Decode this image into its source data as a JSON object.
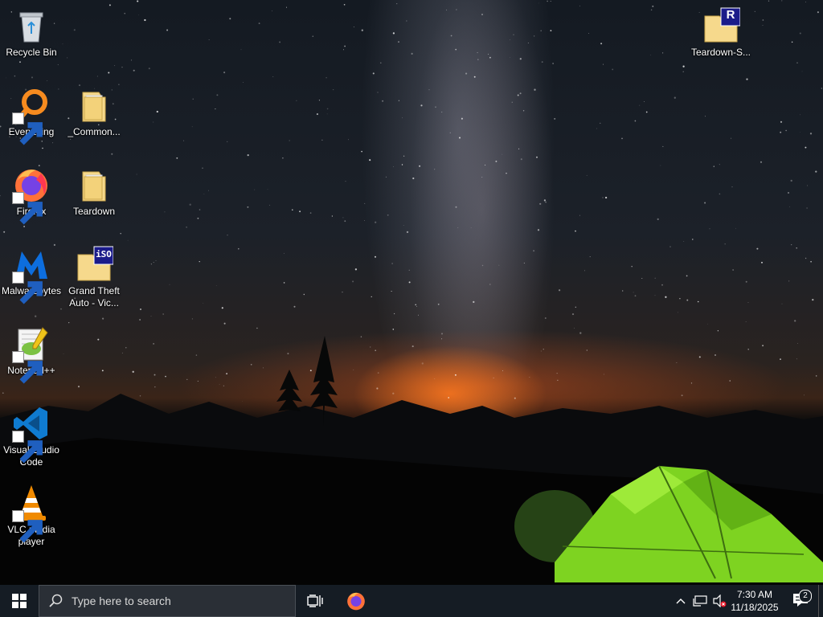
{
  "desktop_icons": [
    {
      "label": "Recycle Bin",
      "icon": "recycle-bin-icon"
    },
    {
      "label": "Everything",
      "icon": "everything-search-icon"
    },
    {
      "label": "_Common...",
      "icon": "folder-icon"
    },
    {
      "label": "Firefox",
      "icon": "firefox-icon"
    },
    {
      "label": "Teardown",
      "icon": "folder-icon"
    },
    {
      "label": "Malwarebytes",
      "icon": "malwarebytes-icon"
    },
    {
      "label": "Grand Theft Auto - Vic...",
      "icon": "iso-folder-icon",
      "badge": "iSO"
    },
    {
      "label": "Notepad++",
      "icon": "notepad-plus-plus-icon"
    },
    {
      "label": "Visual Studio Code",
      "icon": "vscode-icon"
    },
    {
      "label": "VLC media player",
      "icon": "vlc-icon"
    },
    {
      "label": "Teardown-S...",
      "icon": "rar-folder-icon",
      "badge": "R"
    }
  ],
  "taskbar": {
    "search_placeholder": "Type here to search",
    "pinned": [
      "firefox-icon"
    ],
    "tray": {
      "time": "7:30 AM",
      "date": "11/18/2025",
      "notification_count": "2",
      "icons": [
        "chevron-up-icon",
        "network-icon",
        "volume-muted-icon",
        "notification-icon"
      ]
    }
  },
  "colors": {
    "taskbar_bg": "#151c24",
    "search_bg": "#2a2f36",
    "tent_green": "#7ed321"
  }
}
